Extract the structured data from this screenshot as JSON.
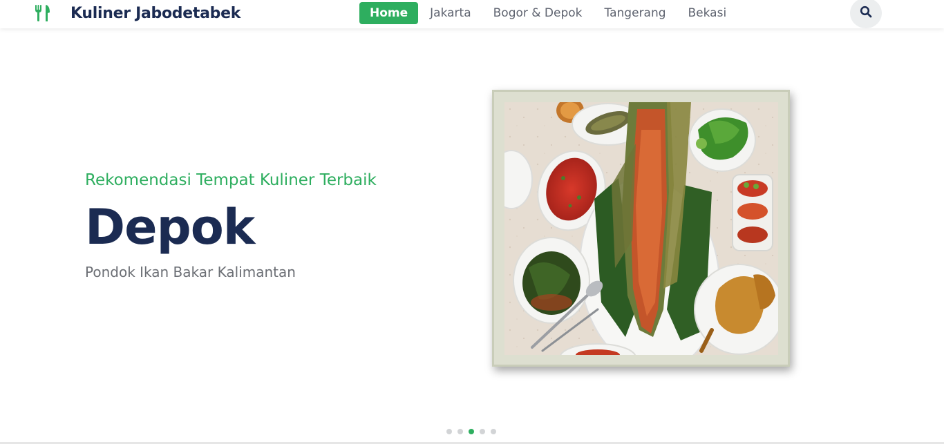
{
  "brand": {
    "name": "Kuliner Jabodetabek",
    "icon": "fork-knife-icon"
  },
  "nav": {
    "items": [
      {
        "label": "Home",
        "active": true
      },
      {
        "label": "Jakarta",
        "active": false
      },
      {
        "label": "Bogor & Depok",
        "active": false
      },
      {
        "label": "Tangerang",
        "active": false
      },
      {
        "label": "Bekasi",
        "active": false
      }
    ],
    "search_icon": "search-icon"
  },
  "hero": {
    "subtitle": "Rekomendasi Tempat Kuliner Terbaik",
    "title": "Depok",
    "description": "Pondok Ikan Bakar Kalimantan"
  },
  "carousel": {
    "slides": 5,
    "active_index": 2
  },
  "colors": {
    "accent": "#2eae5f",
    "navy": "#1b2b52",
    "text_muted": "#6b6e74"
  }
}
